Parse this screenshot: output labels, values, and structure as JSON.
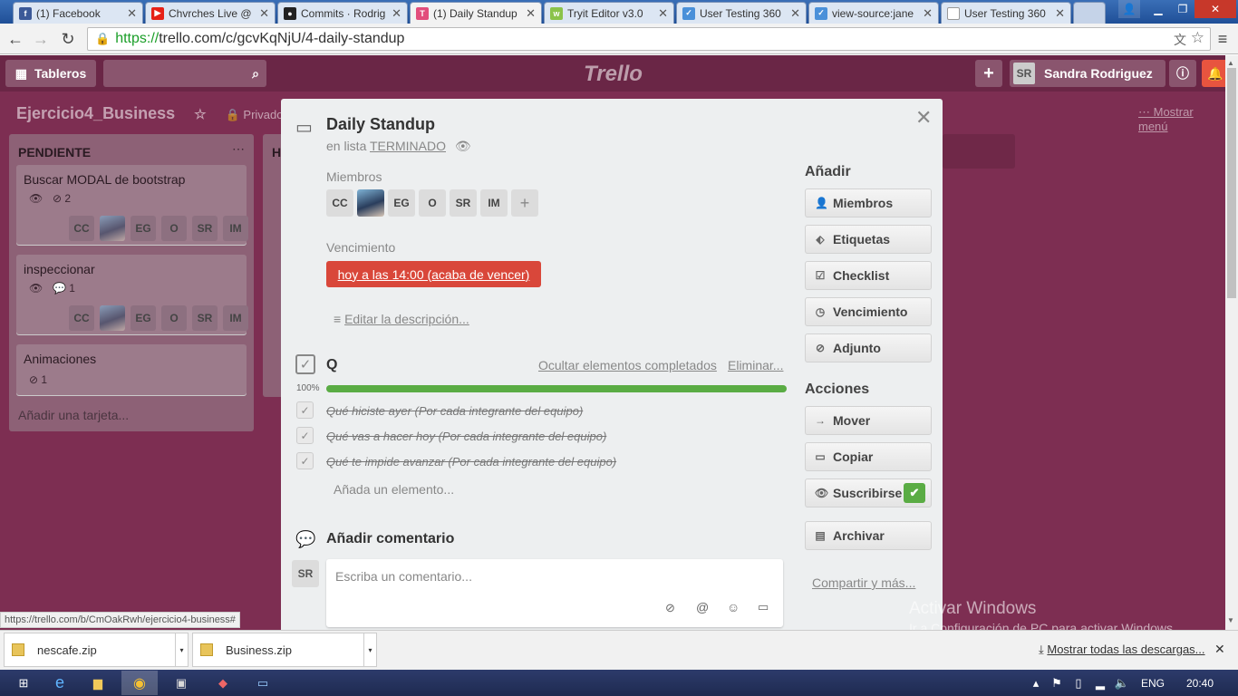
{
  "browser": {
    "tabs": [
      {
        "title": "(1) Facebook",
        "color": "#3b5998",
        "glyph": "f"
      },
      {
        "title": "Chvrches Live @",
        "color": "#e62117",
        "glyph": "▶"
      },
      {
        "title": "Commits · Rodrig",
        "color": "#222222",
        "glyph": "●"
      },
      {
        "title": "(1) Daily Standup",
        "color": "#e24d7c",
        "glyph": "T"
      },
      {
        "title": "Tryit Editor v3.0",
        "color": "#8bc34a",
        "glyph": "w"
      },
      {
        "title": "User Testing 360",
        "color": "#4a90d9",
        "glyph": "✓"
      },
      {
        "title": "view-source:jane",
        "color": "#4a90d9",
        "glyph": "✓"
      },
      {
        "title": "User Testing 360",
        "color": "#999999",
        "glyph": "▢"
      }
    ],
    "url_proto": "https://",
    "url_rest": "trello.com/c/gcvKqNjU/4-daily-standup",
    "status_url": "https://trello.com/b/CmOakRwh/ejercicio4-business#"
  },
  "trello": {
    "boards_label": "Tableros",
    "logo": "Trello",
    "user_initials": "SR",
    "user_name": "Sandra Rodriguez",
    "board_name": "Ejercicio4_Business",
    "privacy": "Privado",
    "show_menu": "Mostrar menú",
    "lists": [
      {
        "title": "PENDIENTE",
        "cards": [
          {
            "title": "Buscar MODAL de bootstrap",
            "badge": "2"
          },
          {
            "title": "inspeccionar",
            "badge": "1"
          },
          {
            "title": "Animaciones",
            "badge": "1"
          }
        ],
        "add_card": "Añadir una tarjeta..."
      }
    ],
    "list2_initial": "H"
  },
  "card": {
    "title": "Daily Standup",
    "in_list_prefix": "en lista",
    "list_name": "TERMINADO",
    "members_label": "Miembros",
    "members": [
      "CC",
      "",
      "EG",
      "O",
      "SR",
      "IM"
    ],
    "due_label": "Vencimiento",
    "due_value": "hoy a las 14:00 (acaba de vencer)",
    "edit_description": "Editar la descripción...",
    "checklist": {
      "title": "Q",
      "hide_completed": "Ocultar elementos completados",
      "delete": "Eliminar...",
      "progress_label": "100%",
      "progress": 100,
      "items": [
        "Qué hiciste ayer (Por cada integrante del equipo)",
        "Qué vas a hacer hoy (Por cada integrante del equipo)",
        "Qué te impide avanzar (Por cada integrante del equipo)"
      ],
      "add_item": "Añada un elemento..."
    },
    "comment": {
      "title": "Añadir comentario",
      "avatar": "SR",
      "placeholder": "Escriba un comentario..."
    },
    "sidebar": {
      "add_title": "Añadir",
      "add_buttons": [
        "Miembros",
        "Etiquetas",
        "Checklist",
        "Vencimiento",
        "Adjunto"
      ],
      "actions_title": "Acciones",
      "action_buttons": [
        "Mover",
        "Copiar",
        "Suscribirse",
        "Archivar"
      ],
      "share": "Compartir y más..."
    }
  },
  "watermark": {
    "line1": "Activar Windows",
    "line2": "Ir a Configuración de PC para activar Windows."
  },
  "downloads": {
    "items": [
      "nescafe.zip",
      "Business.zip"
    ],
    "show_all": "Mostrar todas las descargas..."
  },
  "taskbar": {
    "lang": "ENG",
    "time": "20:40"
  },
  "colors": {
    "board_bg": "#7d2e52",
    "due_red": "#d9473a",
    "progress_green": "#5aac44"
  }
}
